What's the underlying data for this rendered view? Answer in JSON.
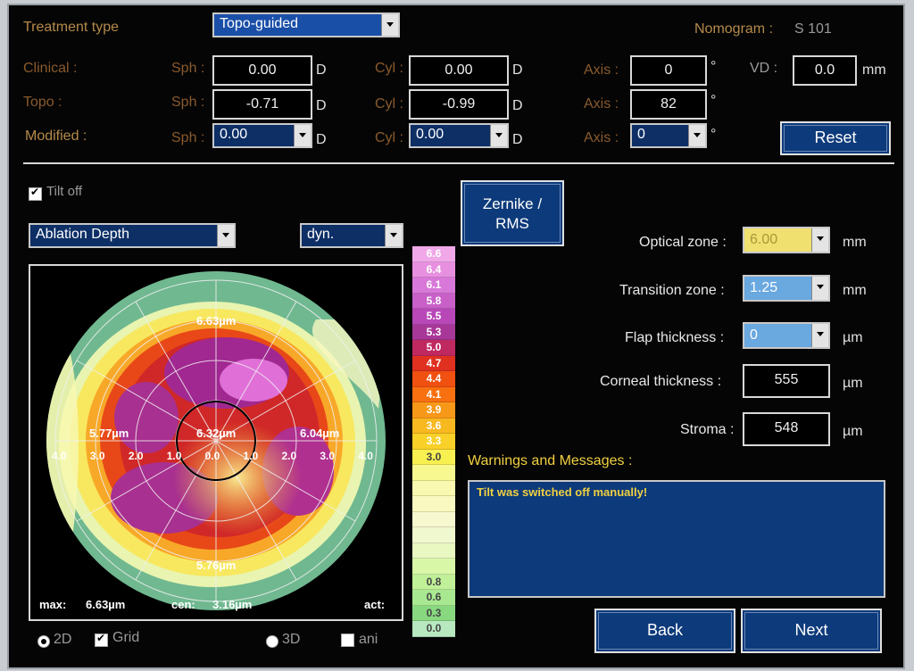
{
  "header": {
    "treatment_type_label": "Treatment type",
    "treatment_type_value": "Topo-guided",
    "nomogram_label": "Nomogram :",
    "nomogram_value": "S 101"
  },
  "refraction": {
    "rows": [
      {
        "label": "Clinical :",
        "sph_label": "Sph :",
        "sph": "0.00",
        "cyl_label": "Cyl :",
        "cyl": "0.00",
        "axis_label": "Axis :",
        "axis": "0"
      },
      {
        "label": "Topo :",
        "sph_label": "Sph :",
        "sph": "-0.71",
        "cyl_label": "Cyl :",
        "cyl": "-0.99",
        "axis_label": "Axis :",
        "axis": "82"
      },
      {
        "label": "Modified :",
        "sph_label": "Sph :",
        "sph": "0.00",
        "cyl_label": "Cyl :",
        "cyl": "0.00",
        "axis_label": "Axis :",
        "axis": "0"
      }
    ],
    "unit_d": "D",
    "unit_deg": "°",
    "vd_label": "VD :",
    "vd_value": "0.0",
    "vd_unit": "mm",
    "reset_label": "Reset"
  },
  "map": {
    "tilt_label": "Tilt off",
    "map_type": "Ablation Depth",
    "scale_mode": "dyn.",
    "zernike_label": "Zernike / RMS",
    "labels": {
      "top": "6.63µm",
      "left": "5.77µm",
      "center": "6.32µm",
      "right": "6.04µm",
      "bottom": "5.76µm"
    },
    "axis_ticks": [
      "4.0",
      "3.0",
      "2.0",
      "1.0",
      "0.0",
      "1.0",
      "2.0",
      "3.0",
      "4.0"
    ],
    "max_label": "max:",
    "max_value": "6.63µm",
    "cen_label": "cen:",
    "cen_value": "3.16µm",
    "act_label": "act:",
    "view_2d": "2D",
    "grid_label": "Grid",
    "view_3d": "3D",
    "ani_label": "ani"
  },
  "color_scale": {
    "values": [
      "6.6",
      "6.4",
      "6.1",
      "5.8",
      "5.5",
      "5.3",
      "5.0",
      "4.7",
      "4.4",
      "4.1",
      "3.9",
      "3.6",
      "3.3",
      "3.0",
      "",
      "",
      "",
      "",
      "",
      "",
      "",
      "0.8",
      "0.6",
      "0.3",
      "0.0"
    ],
    "colors": [
      "#f0a8e8",
      "#e890e0",
      "#d878d8",
      "#c860c8",
      "#b848b8",
      "#a83898",
      "#c02860",
      "#e03020",
      "#f05010",
      "#f87010",
      "#f89818",
      "#f8b820",
      "#f8d028",
      "#f8f050",
      "#f8f890",
      "#f8f8b0",
      "#f8f8c0",
      "#f8f8d0",
      "#f0f8d0",
      "#e8f8c0",
      "#d8f8a8",
      "#c0f098",
      "#a8e890",
      "#88d880",
      "#b8e8c0"
    ]
  },
  "parameters": {
    "optical_zone_label": "Optical zone :",
    "optical_zone_value": "6.00",
    "transition_zone_label": "Transition zone :",
    "transition_zone_value": "1.25",
    "flap_label": "Flap thickness :",
    "flap_value": "0",
    "corneal_label": "Corneal thickness :",
    "corneal_value": "555",
    "stroma_label": "Stroma :",
    "stroma_value": "548",
    "unit_mm": "mm",
    "unit_um": "µm"
  },
  "messages": {
    "title": "Warnings and Messages :",
    "text": "Tilt was switched off manually!"
  },
  "nav": {
    "back_label": "Back",
    "next_label": "Next"
  }
}
